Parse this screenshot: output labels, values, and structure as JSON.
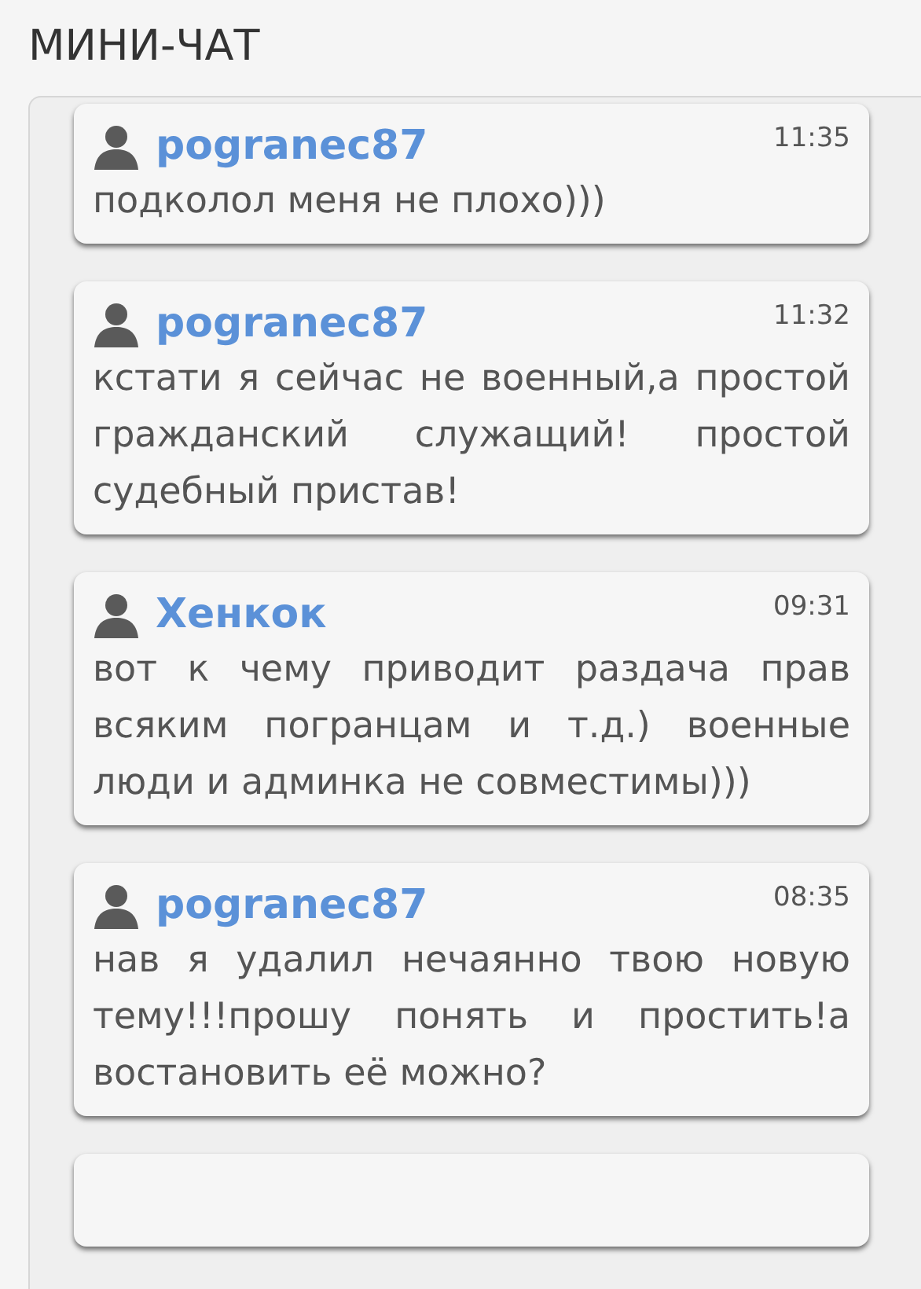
{
  "title": "МИНИ-ЧАТ",
  "messages": [
    {
      "user": "pogranec87",
      "time": "11:35",
      "text": "подколол меня не плохо)))"
    },
    {
      "user": "pogranec87",
      "time": "11:32",
      "text": "кстати я сейчас не военный,а простой гражданский служащий! простой судебный пристав!"
    },
    {
      "user": "Хенкок",
      "time": "09:31",
      "text": "вот к чему приводит раздача прав всяким погранцам и т.д.) военные люди и админка не совместимы)))"
    },
    {
      "user": "pogranec87",
      "time": "08:35",
      "text": "нав я удалил нечаянно твою новую тему!!!прошу понять и простить!а востановить её можно?"
    }
  ]
}
